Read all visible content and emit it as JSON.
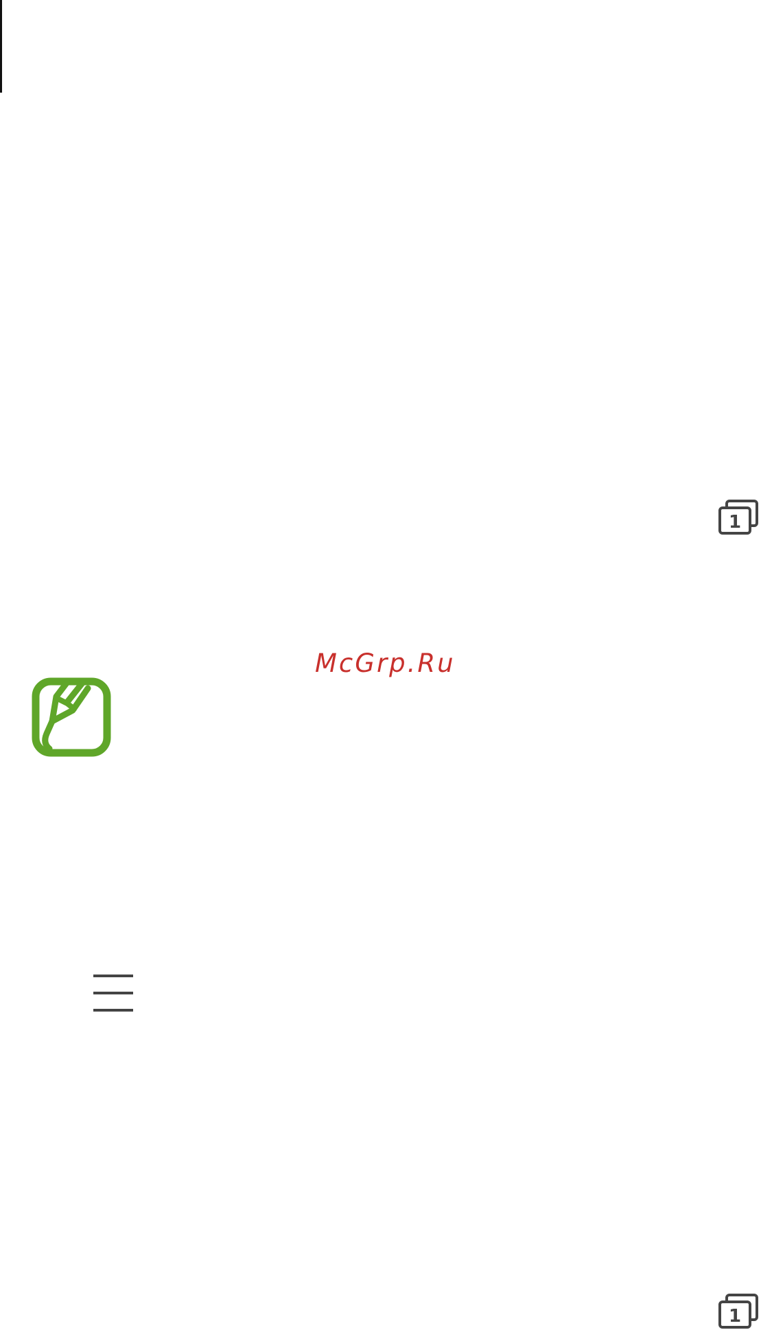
{
  "watermark": {
    "text": "McGrp.Ru",
    "color": "#c8302c"
  },
  "icons": {
    "window_top": "multi-window-icon",
    "window_bottom": "multi-window-icon",
    "window_number": "1",
    "note": "note-pencil-icon",
    "menu": "hamburger-menu-icon",
    "note_color": "#5fa629",
    "icon_color": "#444444"
  }
}
